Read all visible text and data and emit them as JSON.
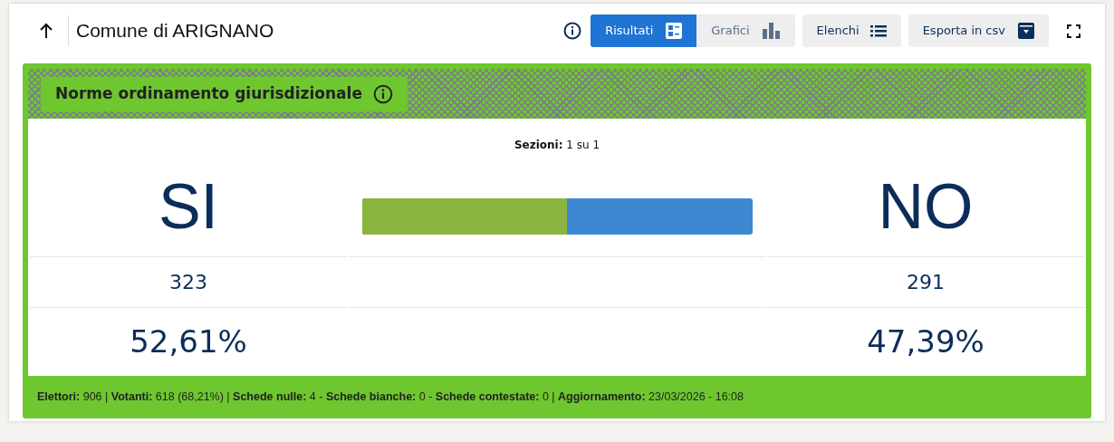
{
  "header": {
    "title": "Comune di ARIGNANO"
  },
  "tabs": [
    {
      "label": "Risultati",
      "selected": true
    },
    {
      "label": "Grafici",
      "selected": false
    }
  ],
  "buttons": [
    "Elenchi",
    "Esporta in csv"
  ],
  "referendum": {
    "title": "Norme ordinamento giurisdizionale",
    "sections": "**Sezioni:** 1 su 1",
    "options": [
      {
        "label": "SI",
        "votes": "323",
        "percent": "52,61%",
        "color": "#8bb43f"
      },
      {
        "label": "NO",
        "votes": "291",
        "percent": "47,39%",
        "color": "#3e88d2"
      }
    ],
    "bar": {
      "level": 0.5261
    },
    "footer": "**Elettori:** 906 | **Votanti:** 618 (68,21%) | **Schede nulle:** 4 - **Schede bianche:** 0 - **Schede contestate:** 0 | **Aggiornamento:** 23/03/2026 - 16:08"
  }
}
